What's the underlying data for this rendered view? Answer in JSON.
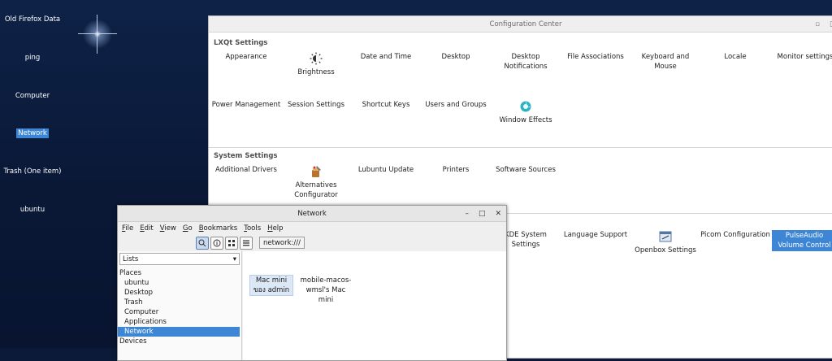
{
  "desktop": {
    "icons": [
      {
        "label": "Old Firefox Data"
      },
      {
        "label": "ping"
      },
      {
        "label": "Computer"
      },
      {
        "label": "Network"
      },
      {
        "label": "Trash (One item)"
      },
      {
        "label": "ubuntu"
      }
    ]
  },
  "config_center": {
    "title": "Configuration Center",
    "title_buttons": [
      "▫",
      "□"
    ],
    "lxqt_section": "LXQt Settings",
    "lxqt_items": [
      {
        "label": "Appearance"
      },
      {
        "label": "Brightness",
        "icon": "brightness-icon"
      },
      {
        "label": "Date and Time"
      },
      {
        "label": "Desktop"
      },
      {
        "label": "Desktop Notifications"
      },
      {
        "label": "File Associations"
      },
      {
        "label": "Keyboard and Mouse"
      },
      {
        "label": "Locale"
      },
      {
        "label": "Monitor settings"
      },
      {
        "label": "Power Management"
      },
      {
        "label": "Session Settings"
      },
      {
        "label": "Shortcut Keys"
      },
      {
        "label": "Users and Groups"
      },
      {
        "label": "Window Effects",
        "icon": "window-effects-icon"
      }
    ],
    "system_section": "System Settings",
    "system_items": [
      {
        "label": "Additional Drivers"
      },
      {
        "label": "Alternatives Configurator",
        "icon": "alternatives-icon"
      },
      {
        "label": "Lubuntu Update"
      },
      {
        "label": "Printers"
      },
      {
        "label": "Software Sources"
      }
    ],
    "other_items": [
      {
        "label": "KDE System Settings"
      },
      {
        "label": "Language Support"
      },
      {
        "label": "Openbox Settings",
        "icon": "openbox-icon"
      },
      {
        "label": "Picom Configuration"
      },
      {
        "label": "PulseAudio Volume Control"
      }
    ]
  },
  "network_window": {
    "title": "Network",
    "title_buttons": [
      "–",
      "□",
      "✕"
    ],
    "menu": [
      "File",
      "Edit",
      "View",
      "Go",
      "Bookmarks",
      "Tools",
      "Help"
    ],
    "path": "network:///",
    "side_combo": "Lists",
    "places_header": "Places",
    "places": [
      "ubuntu",
      "Desktop",
      "Trash",
      "Computer",
      "Applications",
      "Network"
    ],
    "devices_header": "Devices",
    "files": [
      {
        "label": "Mac mini ของ admin"
      },
      {
        "label": "mobile-macos-wmsl's Mac mini"
      }
    ]
  },
  "colors": {
    "selection": "#3d86d6",
    "desktop_bg": "#0b1a38"
  }
}
